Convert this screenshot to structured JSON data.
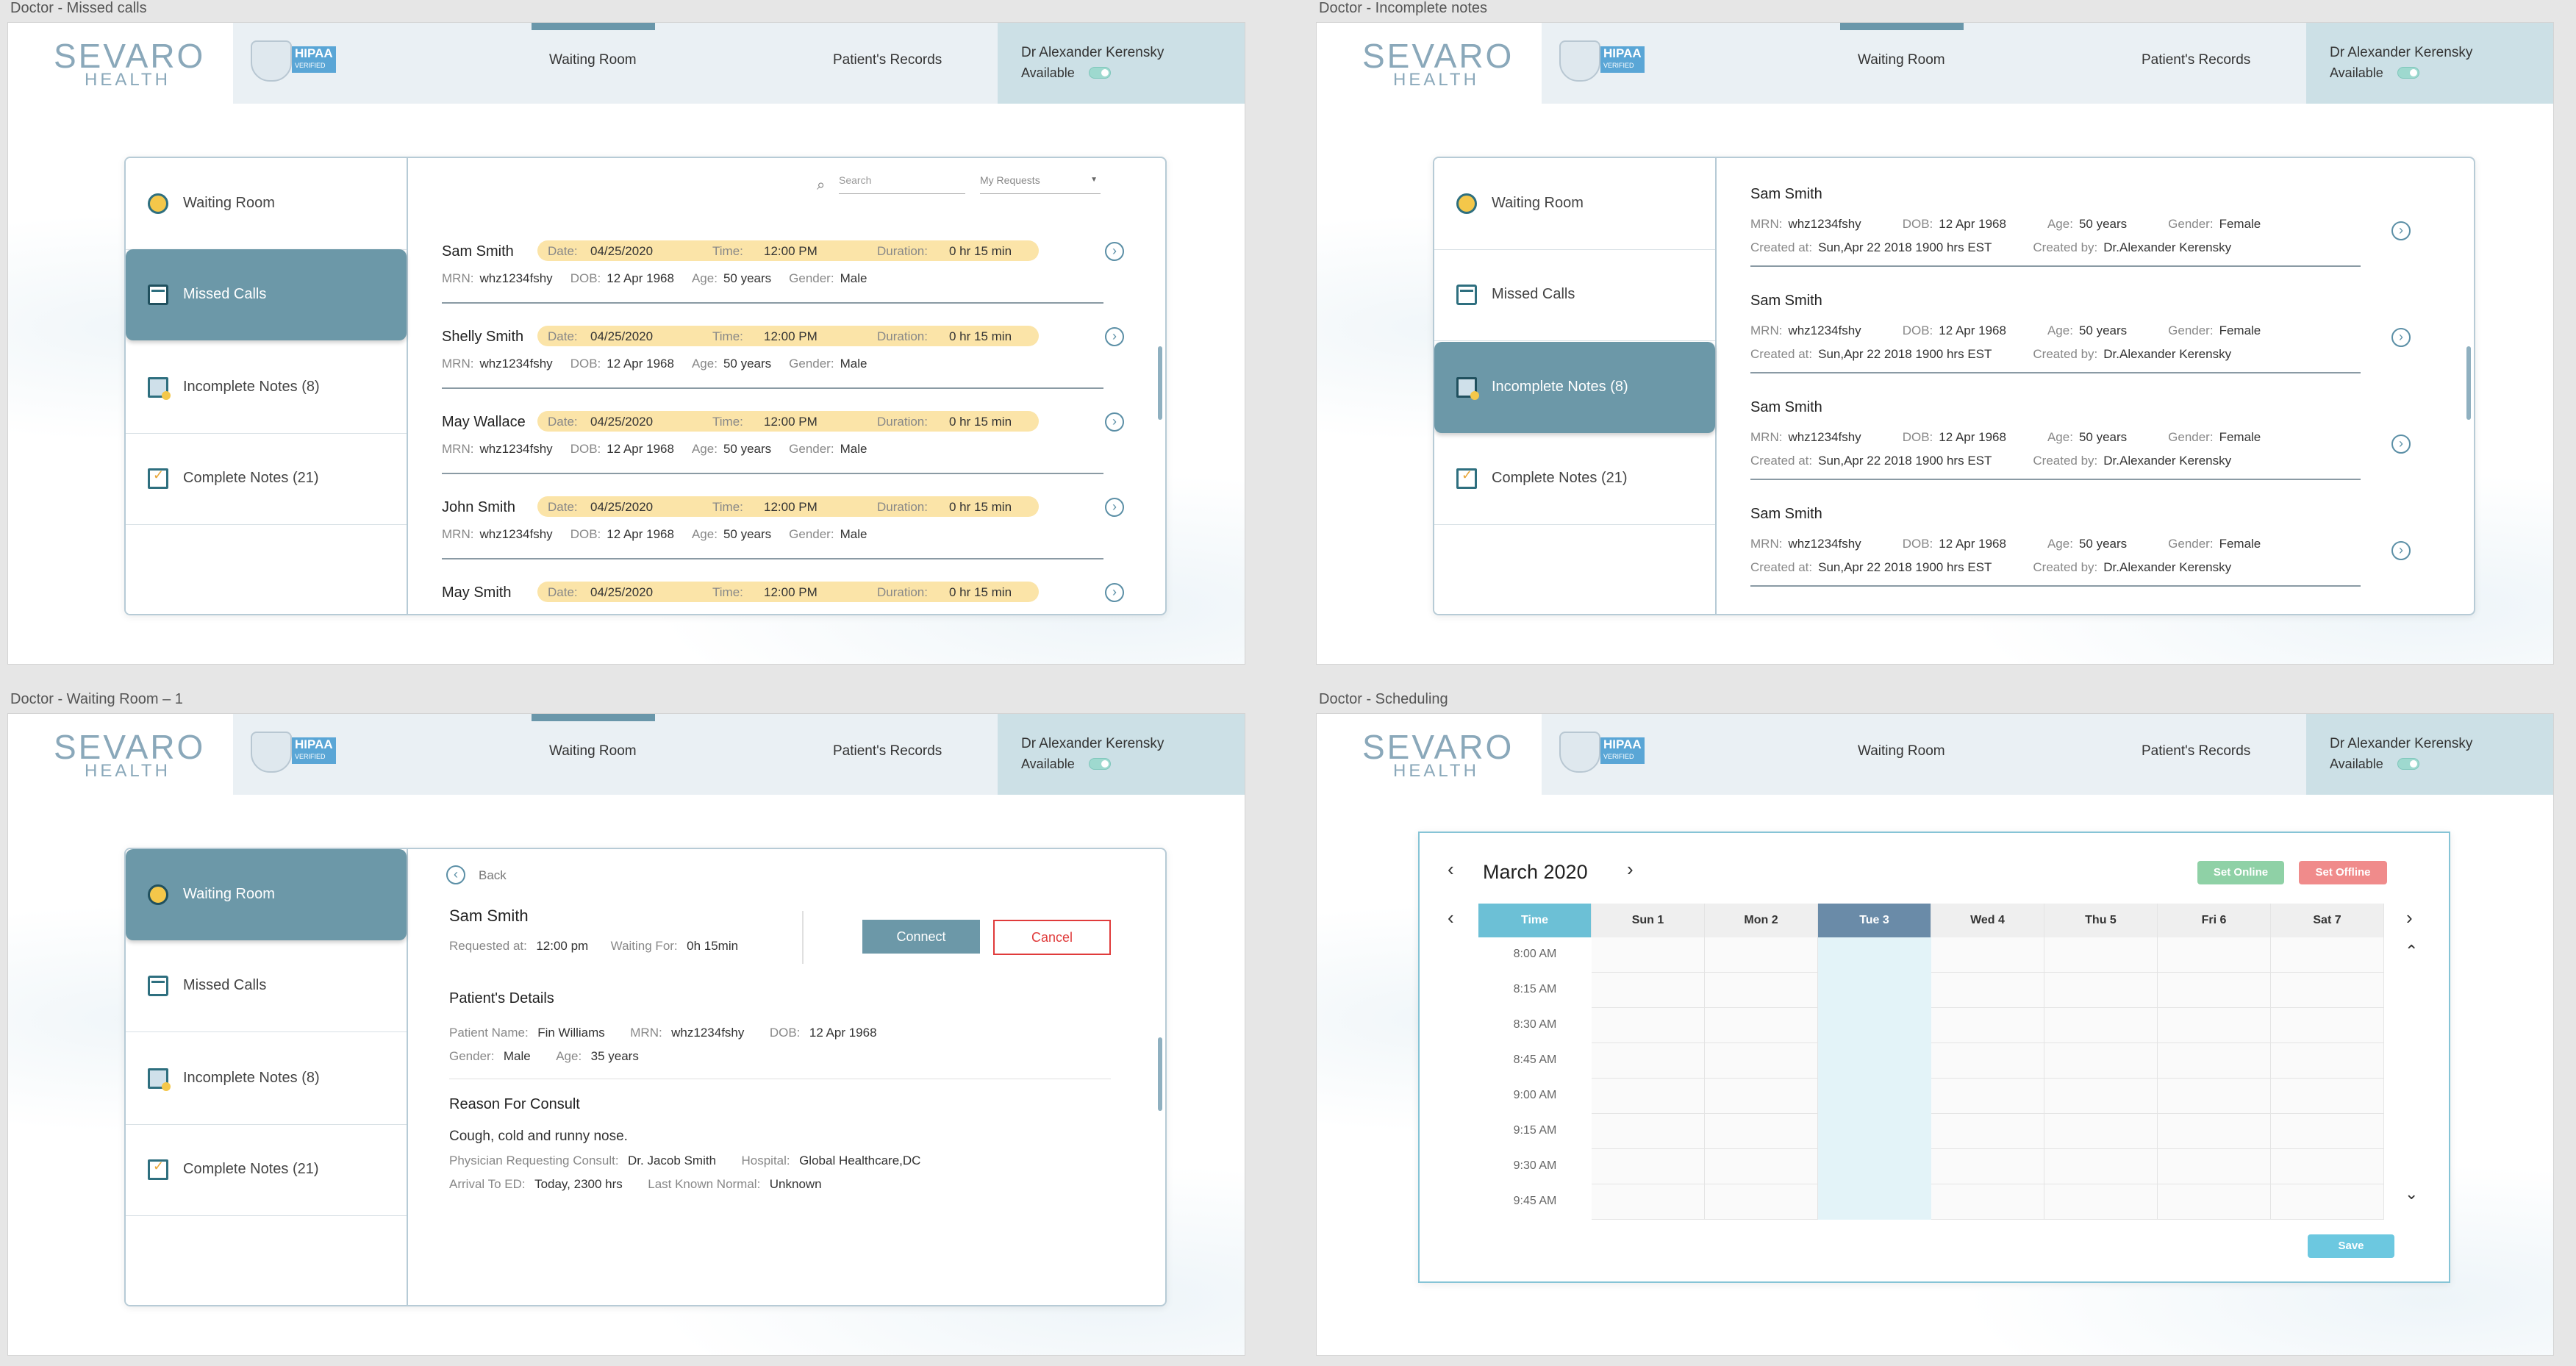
{
  "brand": {
    "logo_main": "SEVARO",
    "logo_sub": "HEALTH",
    "hipaa_badge": "HIPAA",
    "hipaa_small": "VERIFIED"
  },
  "header": {
    "nav_waiting": "Waiting Room",
    "nav_records": "Patient's Records",
    "user_name": "Dr Alexander Kerensky",
    "user_status": "Available"
  },
  "sidebar": {
    "waiting": "Waiting Room",
    "missed": "Missed Calls",
    "incomplete": "Incomplete Notes (8)",
    "complete": "Complete Notes (21)"
  },
  "frames": {
    "missed_title": "Doctor - Missed calls",
    "incomplete_title": "Doctor - Incomplete notes",
    "waiting_title": "Doctor - Waiting Room – 1",
    "scheduling_title": "Doctor - Scheduling"
  },
  "missed_calls": {
    "search_placeholder": "Search",
    "filter": "My Requests",
    "labels": {
      "date": "Date:",
      "time": "Time:",
      "duration": "Duration:",
      "mrn": "MRN:",
      "dob": "DOB:",
      "age": "Age:",
      "gender": "Gender:"
    },
    "rows": [
      {
        "name": "Sam Smith",
        "date": "04/25/2020",
        "time": "12:00 PM",
        "duration": "0 hr 15 min",
        "mrn": "whz1234fshy",
        "dob": "12 Apr 1968",
        "age": "50 years",
        "gender": "Male"
      },
      {
        "name": "Shelly Smith",
        "date": "04/25/2020",
        "time": "12:00 PM",
        "duration": "0 hr 15 min",
        "mrn": "whz1234fshy",
        "dob": "12 Apr 1968",
        "age": "50 years",
        "gender": "Male"
      },
      {
        "name": "May Wallace",
        "date": "04/25/2020",
        "time": "12:00 PM",
        "duration": "0 hr 15 min",
        "mrn": "whz1234fshy",
        "dob": "12 Apr 1968",
        "age": "50 years",
        "gender": "Male"
      },
      {
        "name": "John Smith",
        "date": "04/25/2020",
        "time": "12:00 PM",
        "duration": "0 hr 15 min",
        "mrn": "whz1234fshy",
        "dob": "12 Apr 1968",
        "age": "50 years",
        "gender": "Male"
      },
      {
        "name": "May Smith",
        "date": "04/25/2020",
        "time": "12:00 PM",
        "duration": "0 hr 15 min"
      }
    ]
  },
  "incomplete_notes": {
    "labels": {
      "mrn": "MRN:",
      "dob": "DOB:",
      "age": "Age:",
      "gender": "Gender:",
      "created_at": "Created at:",
      "created_by": "Created by:"
    },
    "rows": [
      {
        "name": "Sam Smith",
        "mrn": "whz1234fshy",
        "dob": "12 Apr 1968",
        "age": "50 years",
        "gender": "Female",
        "created_at": "Sun,Apr 22 2018  1900 hrs EST",
        "created_by": "Dr.Alexander Kerensky"
      },
      {
        "name": "Sam Smith",
        "mrn": "whz1234fshy",
        "dob": "12 Apr 1968",
        "age": "50 years",
        "gender": "Female",
        "created_at": "Sun,Apr 22 2018  1900 hrs EST",
        "created_by": "Dr.Alexander Kerensky"
      },
      {
        "name": "Sam Smith",
        "mrn": "whz1234fshy",
        "dob": "12 Apr 1968",
        "age": "50 years",
        "gender": "Female",
        "created_at": "Sun,Apr 22 2018  1900 hrs EST",
        "created_by": "Dr.Alexander Kerensky"
      },
      {
        "name": "Sam Smith",
        "mrn": "whz1234fshy",
        "dob": "12 Apr 1968",
        "age": "50 years",
        "gender": "Female",
        "created_at": "Sun,Apr 22 2018  1900 hrs EST",
        "created_by": "Dr.Alexander Kerensky"
      }
    ]
  },
  "waiting_room": {
    "back": "Back",
    "patient_name": "Sam Smith",
    "requested_label": "Requested at:",
    "requested_value": "12:00 pm",
    "waiting_label": "Waiting For:",
    "waiting_value": "0h 15min",
    "connect": "Connect",
    "cancel": "Cancel",
    "details_heading": "Patient's Details",
    "pname_label": "Patient Name:",
    "pname_value": "Fin Williams",
    "mrn_label": "MRN:",
    "mrn_value": "whz1234fshy",
    "dob_label": "DOB:",
    "dob_value": "12 Apr 1968",
    "gender_label": "Gender:",
    "gender_value": "Male",
    "age_label": "Age:",
    "age_value": "35 years",
    "reason_heading": "Reason For Consult",
    "reason_text": "Cough, cold and runny nose.",
    "physician_label": "Physician Requesting Consult:",
    "physician_value": "Dr. Jacob Smith",
    "hospital_label": "Hospital:",
    "hospital_value": "Global Healthcare,DC",
    "arrival_label": "Arrival To ED:",
    "arrival_value": "Today, 2300 hrs",
    "lkn_label": "Last Known Normal:",
    "lkn_value": "Unknown"
  },
  "scheduling": {
    "month": "March 2020",
    "set_online": "Set Online",
    "set_offline": "Set Offline",
    "time_header": "Time",
    "days": [
      "Sun 1",
      "Mon 2",
      "Tue 3",
      "Wed 4",
      "Thu 5",
      "Fri 6",
      "Sat 7"
    ],
    "selected_day": "Tue 3",
    "times": [
      "8:00 AM",
      "8:15 AM",
      "8:30 AM",
      "8:45 AM",
      "9:00 AM",
      "9:15 AM",
      "9:30 AM",
      "9:45 AM"
    ],
    "save": "Save"
  },
  "colors": {
    "accent": "#6c98a8",
    "pill": "#fbe4a8",
    "cancel": "#e03b3b",
    "time_header": "#6cc0d6",
    "selected_day": "#6a8ba8",
    "online": "#8fd1a6",
    "offline": "#f08b8b",
    "save": "#6cc8e0"
  }
}
